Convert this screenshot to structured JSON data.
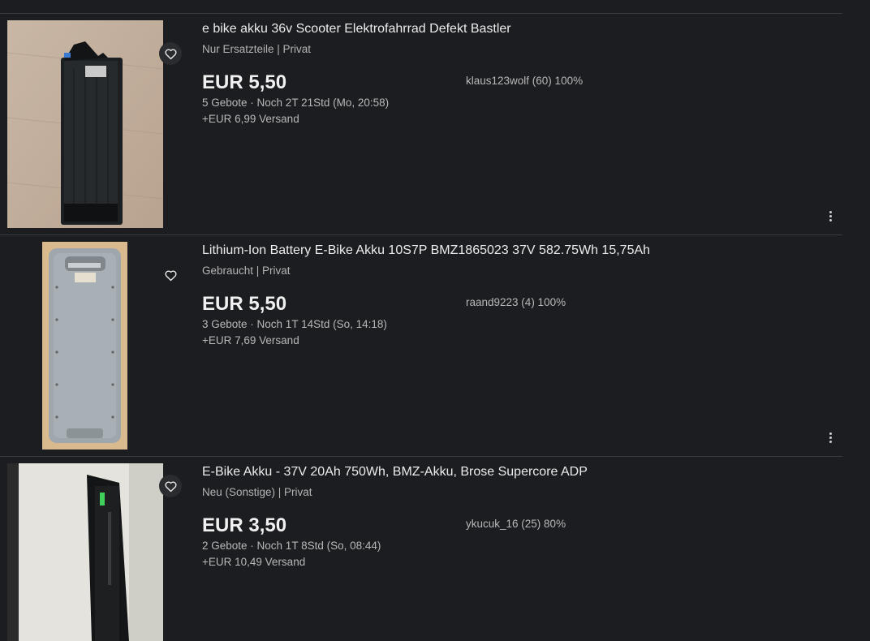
{
  "listings": [
    {
      "title": "e bike akku 36v Scooter Elektrofahrrad Defekt Bastler",
      "subtitle": "Nur Ersatzteile | Privat",
      "price": "EUR 5,50",
      "bids": "5 Gebote · Noch 2T 21Std (Mo, 20:58)",
      "shipping": "+EUR 6,99 Versand",
      "seller": "klaus123wolf (60) 100%"
    },
    {
      "title": "Lithium-Ion Battery E-Bike Akku 10S7P BMZ1865023 37V 582.75Wh 15,75Ah",
      "subtitle": "Gebraucht | Privat",
      "price": "EUR 5,50",
      "bids": "3 Gebote · Noch 1T 14Std (So, 14:18)",
      "shipping": "+EUR 7,69 Versand",
      "seller": "raand9223 (4) 100%"
    },
    {
      "title": "E-Bike Akku - 37V 20Ah 750Wh, BMZ-Akku, Brose Supercore ADP",
      "subtitle": "Neu (Sonstige) | Privat",
      "price": "EUR 3,50",
      "bids": "2 Gebote · Noch 1T 8Std (So, 08:44)",
      "shipping": "+EUR 10,49 Versand",
      "seller": "ykucuk_16 (25) 80%"
    }
  ],
  "icons": {
    "watch": "heart-outline-icon",
    "more": "more-vertical-icon"
  }
}
